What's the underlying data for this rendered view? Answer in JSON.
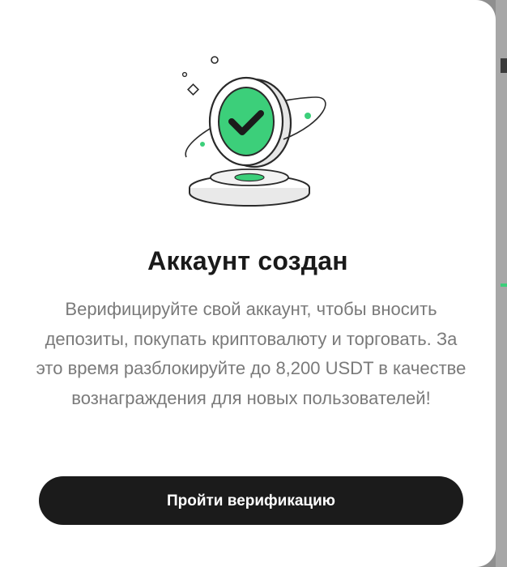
{
  "dialog": {
    "title": "Аккаунт создан",
    "description": "Верифицируйте свой аккаунт, чтобы вносить депозиты, покупать криптовалюту и торговать. За это время разблокируйте до 8,200 USDT в качестве вознаграждения для новых пользователей!",
    "primary_button_label": "Пройти верификацию"
  },
  "illustration": {
    "icon": "verified-coin-icon",
    "accent_color": "#3ccf7a"
  },
  "colors": {
    "button_bg": "#1b1b1b",
    "title_text": "#1a1a1a",
    "body_text": "#7a7a7a"
  }
}
